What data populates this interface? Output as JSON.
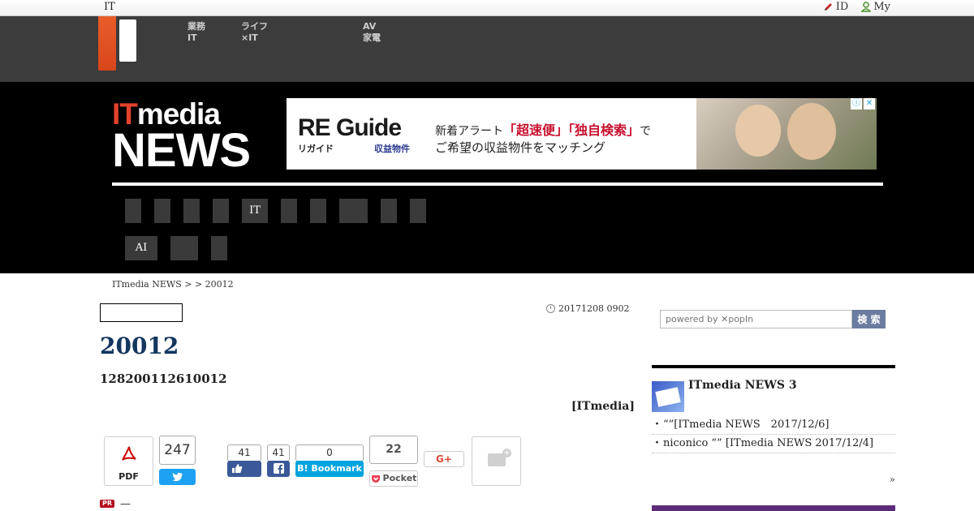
{
  "topbar": {
    "brand": "IT",
    "id_label": "ID",
    "my_label": "My"
  },
  "header_nav": [
    {
      "line1": "業務",
      "line2": "IT"
    },
    {
      "line1": "ライフ",
      "line2": "×IT"
    },
    {
      "line1": "AV",
      "line2": "家電"
    }
  ],
  "site_logo": {
    "it": "IT",
    "media": "media",
    "news": "NEWS"
  },
  "ad": {
    "logo": "RE Guide",
    "kana": "リガイド",
    "tag": "収益物件",
    "line1_pre": "新着アラート",
    "line1_hl": "「超速便」「独自検索」",
    "line1_post": "で",
    "line2": "ご希望の収益物件をマッチング",
    "info": "ⓘ",
    "close": "✕"
  },
  "nav_row1": [
    "",
    "",
    "",
    "",
    "IT",
    "",
    "",
    "",
    "",
    ""
  ],
  "nav_row2": [
    "AI",
    "",
    ""
  ],
  "breadcrumb": "ITmedia NEWS >  > 20012",
  "article": {
    "date": "20171208 0902",
    "title": "20012",
    "subtitle": "128200112610012",
    "byline": "[ITmedia]"
  },
  "share": {
    "pdf_label": "PDF",
    "tweet_count": "247",
    "fb_like_count": "41",
    "fb_share_count": "41",
    "hatena_count": "0",
    "hatena_label": "B! Bookmark",
    "pocket_count": "22",
    "pocket_label": "Pocket",
    "gplus_label": "G+"
  },
  "pr": {
    "badge": "PR",
    "text": "—"
  },
  "sidebar": {
    "search_placeholder": "powered by ✕popIn",
    "search_button": "検 索",
    "box_title": "ITmedia NEWS 3",
    "items": [
      "“”[ITmedia NEWS　2017/12/6]",
      "niconico “” [ITmedia NEWS 2017/12/4]"
    ],
    "more": "»"
  },
  "colors": {
    "accent_orange": "#e3422a",
    "title_blue": "#13365e",
    "twitter": "#1da1f2",
    "facebook": "#3b5998",
    "hatena": "#00a4de",
    "pocket": "#ef4056"
  }
}
